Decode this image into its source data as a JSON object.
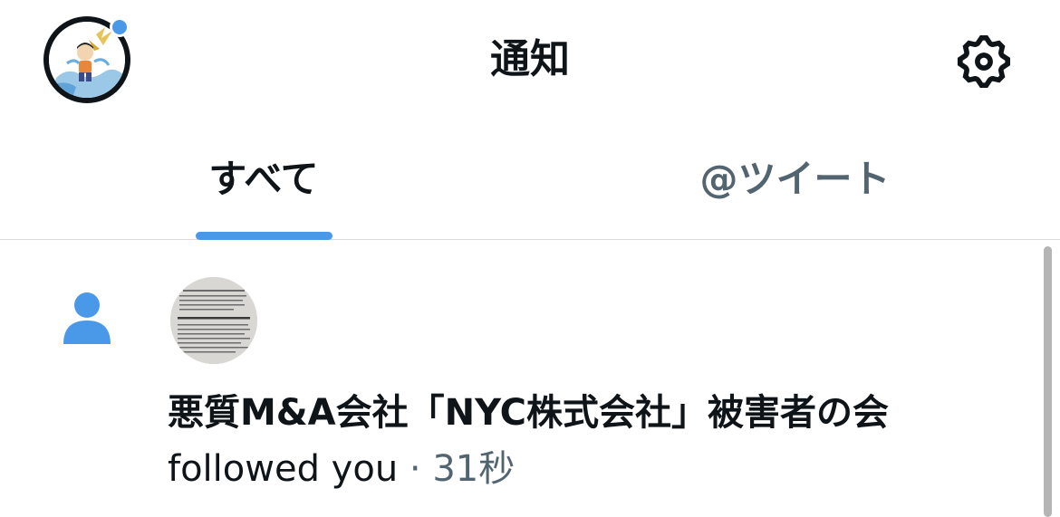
{
  "header": {
    "title": "通知"
  },
  "tabs": [
    {
      "label": "すべて",
      "selected": true
    },
    {
      "label": "@ツイート",
      "selected": false
    }
  ],
  "notification": {
    "type": "follow",
    "name": "悪質M&A会社「NYC株式会社」被害者の会",
    "action": "followed you",
    "separator": "·",
    "time": "31秒"
  },
  "icons": {
    "settings": "gear-icon",
    "notification_type": "person-icon"
  },
  "colors": {
    "accent": "#4a99e9",
    "text": "#0f1419",
    "secondary_text": "#536471"
  }
}
